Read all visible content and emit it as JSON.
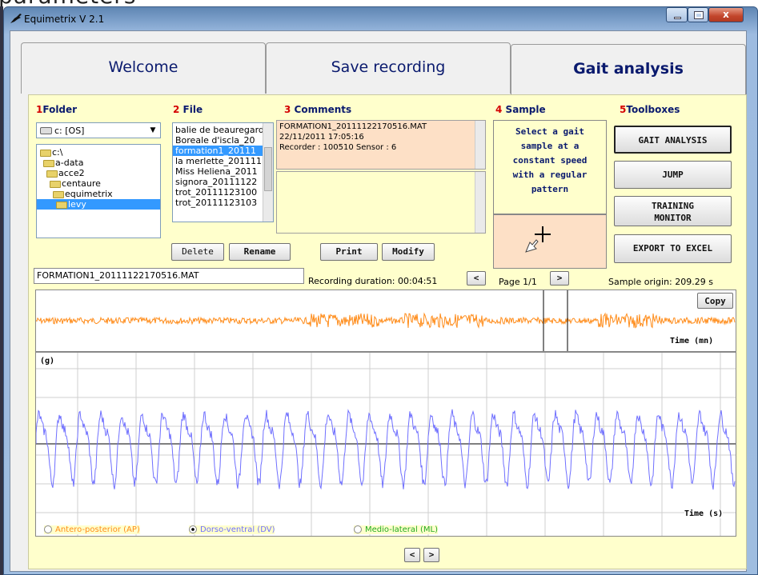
{
  "top_strip_text": "parameters",
  "window": {
    "title": "Equimetrix V 2.1",
    "close_label": "x"
  },
  "tabs": [
    {
      "label": "Welcome"
    },
    {
      "label": "Save recording"
    },
    {
      "label": "Gait analysis"
    }
  ],
  "sections": {
    "folder": {
      "num": "1",
      "label": "Folder"
    },
    "file": {
      "num": "2",
      "label": "File"
    },
    "comments": {
      "num": "3",
      "label": "Comments"
    },
    "sample": {
      "num": "4",
      "label": "Sample"
    },
    "toolboxes": {
      "num": "5",
      "label": "Toolboxes"
    }
  },
  "drive_select": "c: [OS]",
  "folder_tree": [
    "c:\\",
    "a-data",
    "acce2",
    "centaure",
    "equimetrix",
    "levy"
  ],
  "files": [
    "balie de beauregard",
    "Boreale d'iscla_20",
    "formation1_20111",
    "la merlette_201111",
    "Miss Heliena_2011",
    "signora_20111122",
    "trot_20111123100",
    "trot_20111123103"
  ],
  "comments": {
    "line1": "FORMATION1_20111122170516.MAT",
    "line2": "22/11/2011  17:05:16",
    "line3": "Recorder : 100510   Sensor : 6"
  },
  "sample_text": [
    "Select a gait",
    "sample at a",
    "constant speed",
    "with a regular",
    "pattern"
  ],
  "toolbox_buttons": {
    "gait": "GAIT ANALYSIS",
    "jump": "JUMP",
    "training1": "TRAINING",
    "training2": "MONITOR",
    "export": "EXPORT TO EXCEL"
  },
  "file_buttons": {
    "delete": "Delete",
    "rename": "Rename",
    "print": "Print",
    "modify": "Modify"
  },
  "filename_field": "FORMATION1_20111122170516.MAT",
  "recording_duration": "Recording duration: 00:04:51",
  "page_label": "Page 1/1",
  "sample_origin": "Sample origin:  209.29 s",
  "copy_label": "Copy",
  "overview_axis": "Time (mn)",
  "detail_axis": "Time (s)",
  "detail_unit": "(g)",
  "radios": {
    "ap": "Antero-posterior (AP)",
    "dv": "Dorso-ventral (DV)",
    "ml": "Medio-lateral (ML)"
  },
  "nav": {
    "prev": "<",
    "next": ">"
  },
  "colors": {
    "panel": "#ffffcc",
    "orange": "#ff8c1a",
    "blue": "#6f6fff",
    "tab_text": "#0a1a6e",
    "red_num": "#d40000"
  }
}
